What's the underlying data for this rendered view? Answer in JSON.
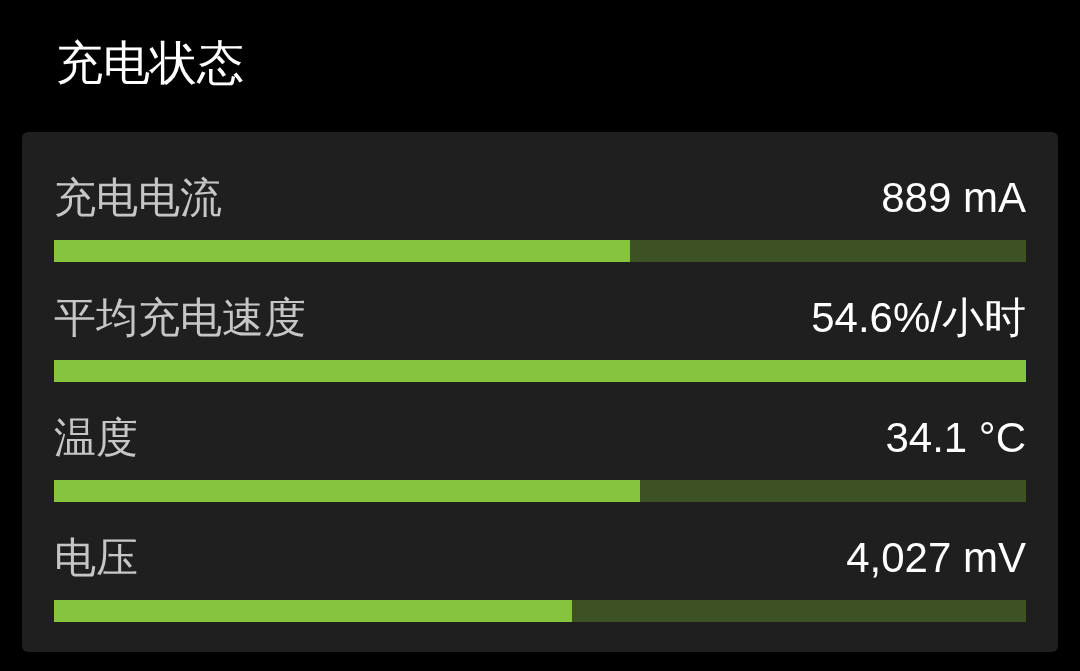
{
  "title": "充电状态",
  "metrics": [
    {
      "label": "充电电流",
      "reading": "889 mA",
      "level": 0.593
    },
    {
      "label": "平均充电速度",
      "reading": "54.6%/小时",
      "level": 1.0
    },
    {
      "label": "温度",
      "reading": "34.1 °C",
      "level": 0.603
    },
    {
      "label": "电压",
      "reading": "4,027 mV",
      "level": 0.533
    }
  ]
}
